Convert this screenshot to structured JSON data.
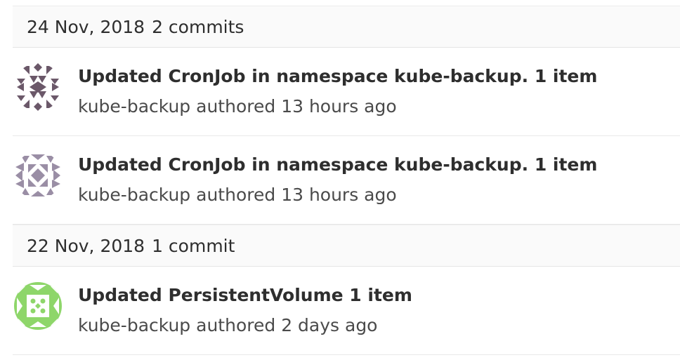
{
  "groups": [
    {
      "date": "24 Nov, 2018",
      "count": "2 commits",
      "commits": [
        {
          "title": "Updated CronJob in namespace kube-backup. 1 item",
          "author": "kube-backup",
          "verb": "authored",
          "time": "13 hours ago",
          "avatar_icon": "identicon-icon",
          "avatar_color": "#6b5869"
        },
        {
          "title": "Updated CronJob in namespace kube-backup. 1 item",
          "author": "kube-backup",
          "verb": "authored",
          "time": "13 hours ago",
          "avatar_icon": "identicon-icon",
          "avatar_color": "#9a8ea5"
        }
      ]
    },
    {
      "date": "22 Nov, 2018",
      "count": "1 commit",
      "commits": [
        {
          "title": "Updated PersistentVolume 1 item",
          "author": "kube-backup",
          "verb": "authored",
          "time": "2 days ago",
          "avatar_icon": "identicon-icon",
          "avatar_color": "#8ed66a"
        }
      ]
    }
  ]
}
